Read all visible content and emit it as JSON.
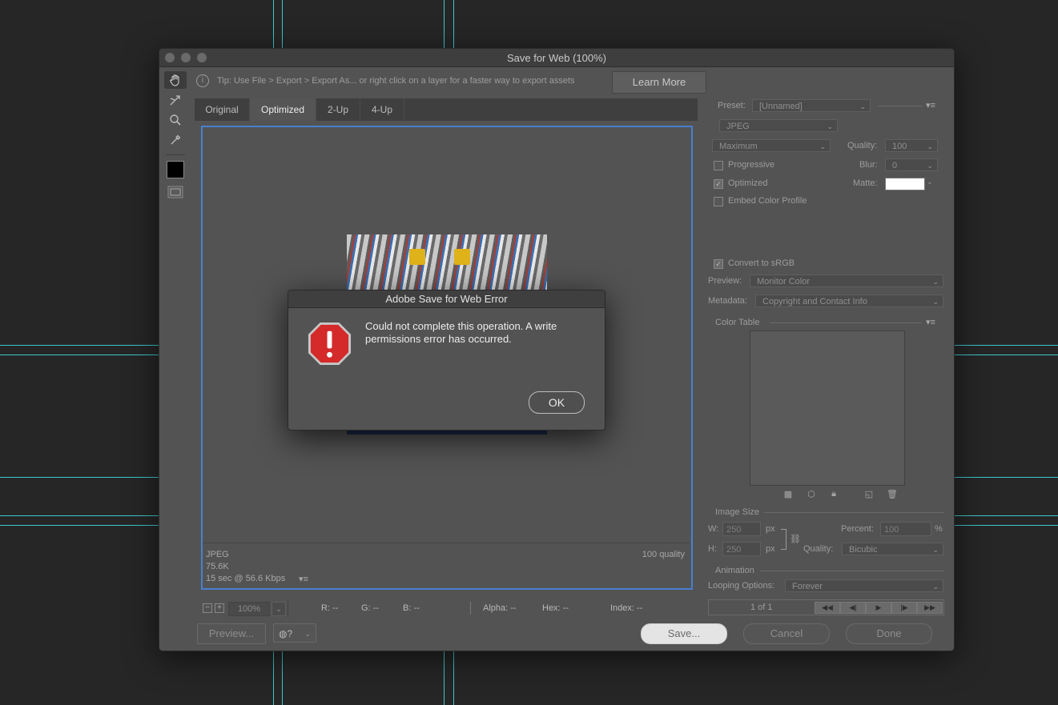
{
  "window": {
    "title": "Save for Web (100%)"
  },
  "tip": {
    "text": "Tip: Use File > Export > Export As...  or right click on a layer for a faster way to export assets",
    "learn_more": "Learn More"
  },
  "tabs": [
    {
      "label": "Original"
    },
    {
      "label": "Optimized"
    },
    {
      "label": "2-Up"
    },
    {
      "label": "4-Up"
    }
  ],
  "image_info": {
    "format": "JPEG",
    "size": "75.6K",
    "download_time": "15 sec @ 56.6 Kbps",
    "quality": "100 quality"
  },
  "status": {
    "zoom": "100%",
    "r": "R: --",
    "g": "G: --",
    "b": "B: --",
    "alpha": "Alpha: --",
    "hex": "Hex: --",
    "index": "Index: --"
  },
  "buttons": {
    "preview": "Preview...",
    "save": "Save...",
    "cancel": "Cancel",
    "done": "Done"
  },
  "settings": {
    "preset_label": "Preset:",
    "preset_value": "[Unnamed]",
    "format": "JPEG",
    "compression": "Maximum",
    "quality_label": "Quality:",
    "quality_value": "100",
    "blur_label": "Blur:",
    "blur_value": "0",
    "matte_label": "Matte:",
    "progressive": "Progressive",
    "optimized": "Optimized",
    "embed_profile": "Embed Color Profile",
    "convert_srgb": "Convert to sRGB",
    "preview_label": "Preview:",
    "preview_value": "Monitor Color",
    "metadata_label": "Metadata:",
    "metadata_value": "Copyright and Contact Info"
  },
  "color_table": {
    "title": "Color Table"
  },
  "image_size": {
    "title": "Image Size",
    "w_label": "W:",
    "w_value": "250",
    "h_label": "H:",
    "h_value": "250",
    "unit": "px",
    "percent_label": "Percent:",
    "percent_value": "100",
    "percent_unit": "%",
    "quality_label": "Quality:",
    "quality_value": "Bicubic"
  },
  "animation": {
    "title": "Animation",
    "looping_label": "Looping Options:",
    "looping_value": "Forever",
    "frame": "1 of 1"
  },
  "dialog": {
    "title": "Adobe Save for Web Error",
    "message": "Could not complete this operation. A write permissions error has occurred.",
    "ok": "OK"
  },
  "colors": {
    "accent": "#4a7fcf",
    "guide": "#3ec9cf",
    "alert_red": "#d42a2a"
  }
}
